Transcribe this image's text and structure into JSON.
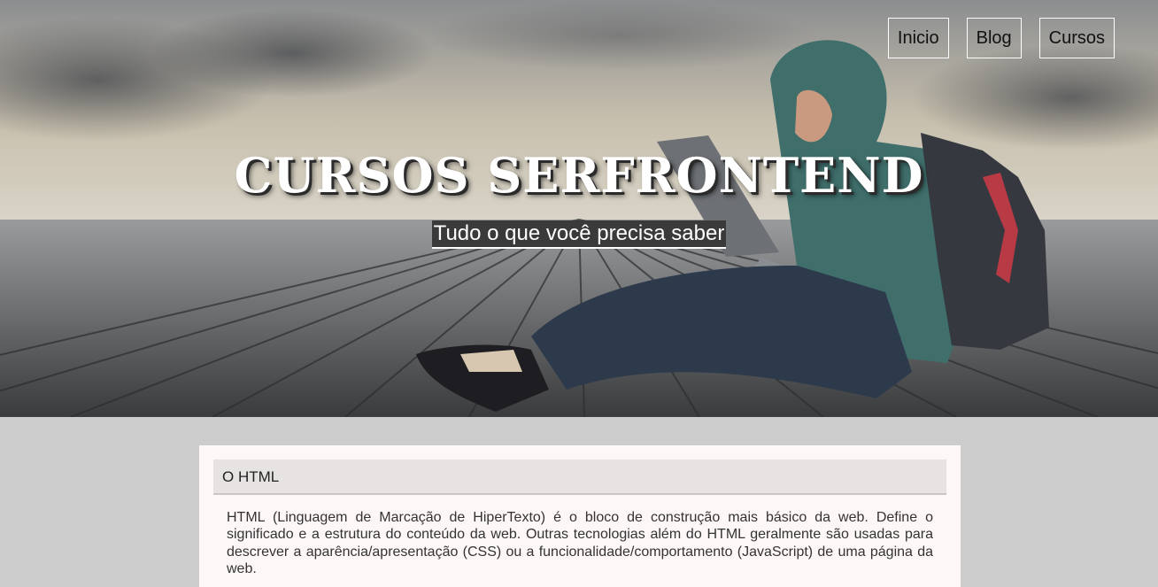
{
  "nav": {
    "items": [
      {
        "label": "Inicio"
      },
      {
        "label": "Blog"
      },
      {
        "label": "Cursos"
      }
    ]
  },
  "hero": {
    "title": "CURSOS SERFRONTEND",
    "subtitle": "Tudo o que você precisa saber"
  },
  "section": {
    "heading": "O HTML",
    "body": "HTML (Linguagem de Marcação de HiperTexto) é o bloco de construção mais básico da web. Define o significado e a estrutura do conteúdo da web. Outras tecnologias além do HTML geralmente são usadas para descrever a aparência/apresentação (CSS) ou a funcionalidade/comportamento (JavaScript) de uma página da web."
  },
  "colors": {
    "page_background": "#cccccc",
    "card_background": "#fdf8f7",
    "header_background": "#e6e3e2"
  }
}
